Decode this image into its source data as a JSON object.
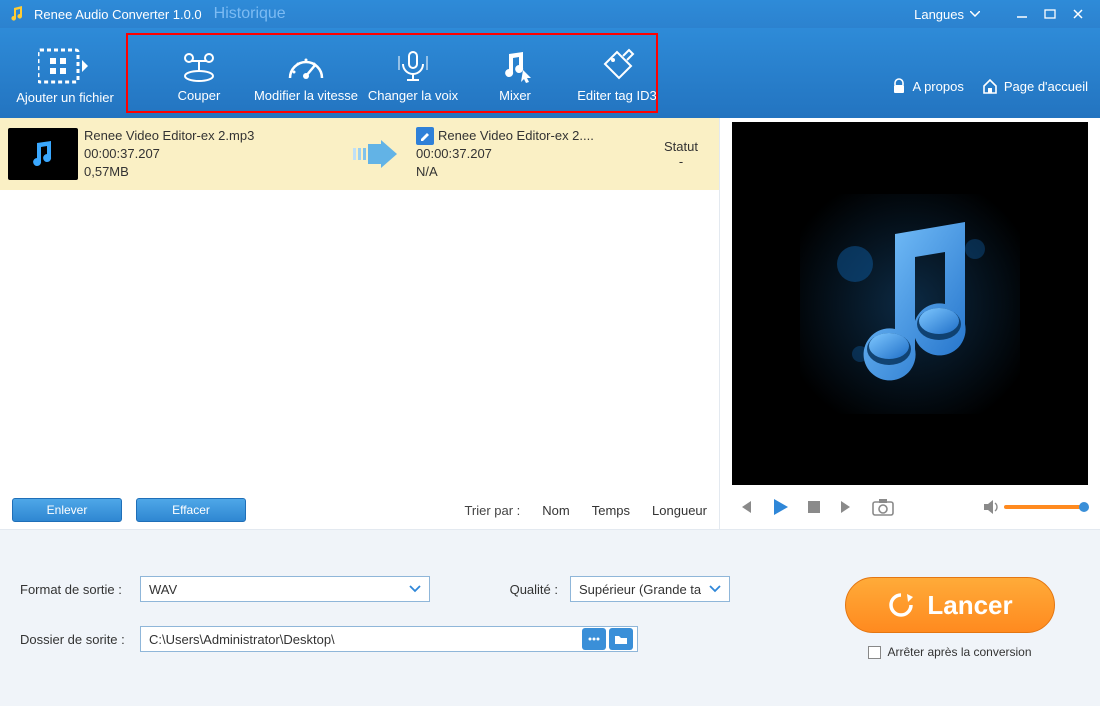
{
  "title": {
    "app": "Renee Audio Converter 1.0.0",
    "history": "Historique",
    "lang": "Langues"
  },
  "toolbar": {
    "add": "Ajouter un fichier",
    "items": [
      {
        "label": "Couper"
      },
      {
        "label": "Modifier la vitesse"
      },
      {
        "label": "Changer la voix"
      },
      {
        "label": "Mixer"
      },
      {
        "label": "Editer tag ID3"
      }
    ],
    "about": "A propos",
    "home": "Page d'accueil"
  },
  "list": {
    "row": {
      "src_name": "Renee Video Editor-ex 2.mp3",
      "src_dur": "00:00:37.207",
      "src_size": "0,57MB",
      "dst_name": "Renee Video Editor-ex 2....",
      "dst_dur": "00:00:37.207",
      "dst_size": "N/A",
      "status_hdr": "Statut",
      "status_val": "-"
    },
    "footer": {
      "remove": "Enlever",
      "clear": "Effacer",
      "sortby": "Trier par :",
      "name": "Nom",
      "time": "Temps",
      "length": "Longueur"
    }
  },
  "output": {
    "format_label": "Format de sortie :",
    "format_value": "WAV",
    "quality_label": "Qualité :",
    "quality_value": "Supérieur (Grande ta",
    "folder_label": "Dossier de sorite :",
    "folder_value": "C:\\Users\\Administrator\\Desktop\\",
    "launch": "Lancer",
    "stop_after": "Arrêter après la conversion"
  }
}
